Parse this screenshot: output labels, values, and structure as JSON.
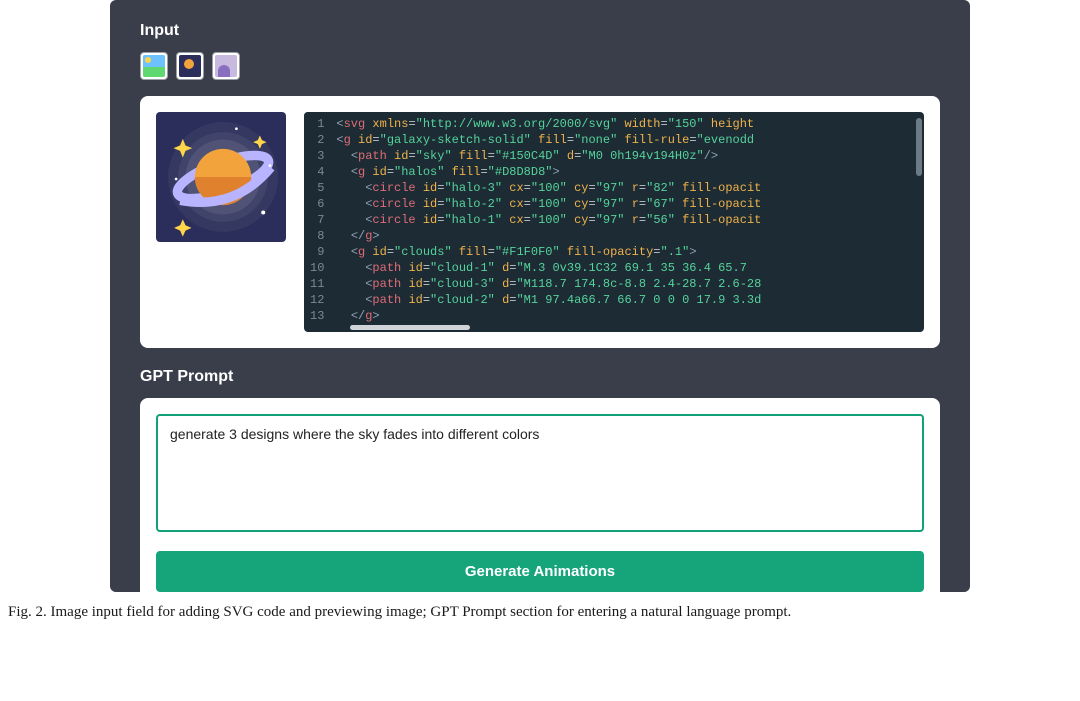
{
  "sections": {
    "input_label": "Input",
    "gpt_label": "GPT Prompt"
  },
  "thumbs": [
    {
      "name": "scenery-thumb"
    },
    {
      "name": "galaxy-thumb"
    },
    {
      "name": "person-thumb"
    }
  ],
  "code": {
    "line_numbers": [
      "1",
      "2",
      "3",
      "4",
      "5",
      "6",
      "7",
      "8",
      "9",
      "10",
      "11",
      "12",
      "13"
    ],
    "lines": [
      {
        "indent": 0,
        "tokens": [
          {
            "t": "angle",
            "v": "<"
          },
          {
            "t": "tag",
            "v": "svg"
          },
          {
            "t": "plain",
            "v": " "
          },
          {
            "t": "attr",
            "v": "xmlns"
          },
          {
            "t": "eq",
            "v": "="
          },
          {
            "t": "str",
            "v": "\"http://www.w3.org/2000/svg\""
          },
          {
            "t": "plain",
            "v": " "
          },
          {
            "t": "attr",
            "v": "width"
          },
          {
            "t": "eq",
            "v": "="
          },
          {
            "t": "str",
            "v": "\"150\""
          },
          {
            "t": "plain",
            "v": " "
          },
          {
            "t": "attr",
            "v": "height"
          }
        ]
      },
      {
        "indent": 0,
        "tokens": [
          {
            "t": "angle",
            "v": "<"
          },
          {
            "t": "tag",
            "v": "g"
          },
          {
            "t": "plain",
            "v": " "
          },
          {
            "t": "attr",
            "v": "id"
          },
          {
            "t": "eq",
            "v": "="
          },
          {
            "t": "str",
            "v": "\"galaxy-sketch-solid\""
          },
          {
            "t": "plain",
            "v": " "
          },
          {
            "t": "attr",
            "v": "fill"
          },
          {
            "t": "eq",
            "v": "="
          },
          {
            "t": "str",
            "v": "\"none\""
          },
          {
            "t": "plain",
            "v": " "
          },
          {
            "t": "attr",
            "v": "fill-rule"
          },
          {
            "t": "eq",
            "v": "="
          },
          {
            "t": "str",
            "v": "\"evenodd"
          }
        ]
      },
      {
        "indent": 1,
        "tokens": [
          {
            "t": "angle",
            "v": "<"
          },
          {
            "t": "tag",
            "v": "path"
          },
          {
            "t": "plain",
            "v": " "
          },
          {
            "t": "attr",
            "v": "id"
          },
          {
            "t": "eq",
            "v": "="
          },
          {
            "t": "str",
            "v": "\"sky\""
          },
          {
            "t": "plain",
            "v": " "
          },
          {
            "t": "attr",
            "v": "fill"
          },
          {
            "t": "eq",
            "v": "="
          },
          {
            "t": "str",
            "v": "\"#150C4D\""
          },
          {
            "t": "plain",
            "v": " "
          },
          {
            "t": "attr",
            "v": "d"
          },
          {
            "t": "eq",
            "v": "="
          },
          {
            "t": "str",
            "v": "\"M0 0h194v194H0z\""
          },
          {
            "t": "close",
            "v": "/>"
          }
        ]
      },
      {
        "indent": 1,
        "tokens": [
          {
            "t": "angle",
            "v": "<"
          },
          {
            "t": "tag",
            "v": "g"
          },
          {
            "t": "plain",
            "v": " "
          },
          {
            "t": "attr",
            "v": "id"
          },
          {
            "t": "eq",
            "v": "="
          },
          {
            "t": "str",
            "v": "\"halos\""
          },
          {
            "t": "plain",
            "v": " "
          },
          {
            "t": "attr",
            "v": "fill"
          },
          {
            "t": "eq",
            "v": "="
          },
          {
            "t": "str",
            "v": "\"#D8D8D8\""
          },
          {
            "t": "angle",
            "v": ">"
          }
        ]
      },
      {
        "indent": 2,
        "tokens": [
          {
            "t": "angle",
            "v": "<"
          },
          {
            "t": "tag",
            "v": "circle"
          },
          {
            "t": "plain",
            "v": " "
          },
          {
            "t": "attr",
            "v": "id"
          },
          {
            "t": "eq",
            "v": "="
          },
          {
            "t": "str",
            "v": "\"halo-3\""
          },
          {
            "t": "plain",
            "v": " "
          },
          {
            "t": "attr",
            "v": "cx"
          },
          {
            "t": "eq",
            "v": "="
          },
          {
            "t": "str",
            "v": "\"100\""
          },
          {
            "t": "plain",
            "v": " "
          },
          {
            "t": "attr",
            "v": "cy"
          },
          {
            "t": "eq",
            "v": "="
          },
          {
            "t": "str",
            "v": "\"97\""
          },
          {
            "t": "plain",
            "v": " "
          },
          {
            "t": "attr",
            "v": "r"
          },
          {
            "t": "eq",
            "v": "="
          },
          {
            "t": "str",
            "v": "\"82\""
          },
          {
            "t": "plain",
            "v": " "
          },
          {
            "t": "attr",
            "v": "fill-opacit"
          }
        ]
      },
      {
        "indent": 2,
        "tokens": [
          {
            "t": "angle",
            "v": "<"
          },
          {
            "t": "tag",
            "v": "circle"
          },
          {
            "t": "plain",
            "v": " "
          },
          {
            "t": "attr",
            "v": "id"
          },
          {
            "t": "eq",
            "v": "="
          },
          {
            "t": "str",
            "v": "\"halo-2\""
          },
          {
            "t": "plain",
            "v": " "
          },
          {
            "t": "attr",
            "v": "cx"
          },
          {
            "t": "eq",
            "v": "="
          },
          {
            "t": "str",
            "v": "\"100\""
          },
          {
            "t": "plain",
            "v": " "
          },
          {
            "t": "attr",
            "v": "cy"
          },
          {
            "t": "eq",
            "v": "="
          },
          {
            "t": "str",
            "v": "\"97\""
          },
          {
            "t": "plain",
            "v": " "
          },
          {
            "t": "attr",
            "v": "r"
          },
          {
            "t": "eq",
            "v": "="
          },
          {
            "t": "str",
            "v": "\"67\""
          },
          {
            "t": "plain",
            "v": " "
          },
          {
            "t": "attr",
            "v": "fill-opacit"
          }
        ]
      },
      {
        "indent": 2,
        "tokens": [
          {
            "t": "angle",
            "v": "<"
          },
          {
            "t": "tag",
            "v": "circle"
          },
          {
            "t": "plain",
            "v": " "
          },
          {
            "t": "attr",
            "v": "id"
          },
          {
            "t": "eq",
            "v": "="
          },
          {
            "t": "str",
            "v": "\"halo-1\""
          },
          {
            "t": "plain",
            "v": " "
          },
          {
            "t": "attr",
            "v": "cx"
          },
          {
            "t": "eq",
            "v": "="
          },
          {
            "t": "str",
            "v": "\"100\""
          },
          {
            "t": "plain",
            "v": " "
          },
          {
            "t": "attr",
            "v": "cy"
          },
          {
            "t": "eq",
            "v": "="
          },
          {
            "t": "str",
            "v": "\"97\""
          },
          {
            "t": "plain",
            "v": " "
          },
          {
            "t": "attr",
            "v": "r"
          },
          {
            "t": "eq",
            "v": "="
          },
          {
            "t": "str",
            "v": "\"56\""
          },
          {
            "t": "plain",
            "v": " "
          },
          {
            "t": "attr",
            "v": "fill-opacit"
          }
        ]
      },
      {
        "indent": 1,
        "tokens": [
          {
            "t": "angle",
            "v": "</"
          },
          {
            "t": "tag",
            "v": "g"
          },
          {
            "t": "angle",
            "v": ">"
          }
        ]
      },
      {
        "indent": 1,
        "tokens": [
          {
            "t": "angle",
            "v": "<"
          },
          {
            "t": "tag",
            "v": "g"
          },
          {
            "t": "plain",
            "v": " "
          },
          {
            "t": "attr",
            "v": "id"
          },
          {
            "t": "eq",
            "v": "="
          },
          {
            "t": "str",
            "v": "\"clouds\""
          },
          {
            "t": "plain",
            "v": " "
          },
          {
            "t": "attr",
            "v": "fill"
          },
          {
            "t": "eq",
            "v": "="
          },
          {
            "t": "str",
            "v": "\"#F1F0F0\""
          },
          {
            "t": "plain",
            "v": " "
          },
          {
            "t": "attr",
            "v": "fill-opacity"
          },
          {
            "t": "eq",
            "v": "="
          },
          {
            "t": "str",
            "v": "\".1\""
          },
          {
            "t": "angle",
            "v": ">"
          }
        ]
      },
      {
        "indent": 2,
        "tokens": [
          {
            "t": "angle",
            "v": "<"
          },
          {
            "t": "tag",
            "v": "path"
          },
          {
            "t": "plain",
            "v": " "
          },
          {
            "t": "attr",
            "v": "id"
          },
          {
            "t": "eq",
            "v": "="
          },
          {
            "t": "str",
            "v": "\"cloud-1\""
          },
          {
            "t": "plain",
            "v": " "
          },
          {
            "t": "attr",
            "v": "d"
          },
          {
            "t": "eq",
            "v": "="
          },
          {
            "t": "str",
            "v": "\"M.3 0v39.1C32 69.1 35 36.4 65.7 "
          }
        ]
      },
      {
        "indent": 2,
        "tokens": [
          {
            "t": "angle",
            "v": "<"
          },
          {
            "t": "tag",
            "v": "path"
          },
          {
            "t": "plain",
            "v": " "
          },
          {
            "t": "attr",
            "v": "id"
          },
          {
            "t": "eq",
            "v": "="
          },
          {
            "t": "str",
            "v": "\"cloud-3\""
          },
          {
            "t": "plain",
            "v": " "
          },
          {
            "t": "attr",
            "v": "d"
          },
          {
            "t": "eq",
            "v": "="
          },
          {
            "t": "str",
            "v": "\"M118.7 174.8c-8.8 2.4-28.7 2.6-28"
          }
        ]
      },
      {
        "indent": 2,
        "tokens": [
          {
            "t": "angle",
            "v": "<"
          },
          {
            "t": "tag",
            "v": "path"
          },
          {
            "t": "plain",
            "v": " "
          },
          {
            "t": "attr",
            "v": "id"
          },
          {
            "t": "eq",
            "v": "="
          },
          {
            "t": "str",
            "v": "\"cloud-2\""
          },
          {
            "t": "plain",
            "v": " "
          },
          {
            "t": "attr",
            "v": "d"
          },
          {
            "t": "eq",
            "v": "="
          },
          {
            "t": "str",
            "v": "\"M1 97.4a66.7 66.7 0 0 0 17.9 3.3d"
          }
        ]
      },
      {
        "indent": 1,
        "tokens": [
          {
            "t": "angle",
            "v": "</"
          },
          {
            "t": "tag",
            "v": "g"
          },
          {
            "t": "angle",
            "v": ">"
          }
        ]
      }
    ]
  },
  "prompt": {
    "text": "generate 3 designs where the sky fades into different colors"
  },
  "buttons": {
    "generate": "Generate Animations"
  },
  "caption": "Fig. 2.  Image input field for adding SVG code and previewing image; GPT Prompt section for entering a natural language prompt."
}
